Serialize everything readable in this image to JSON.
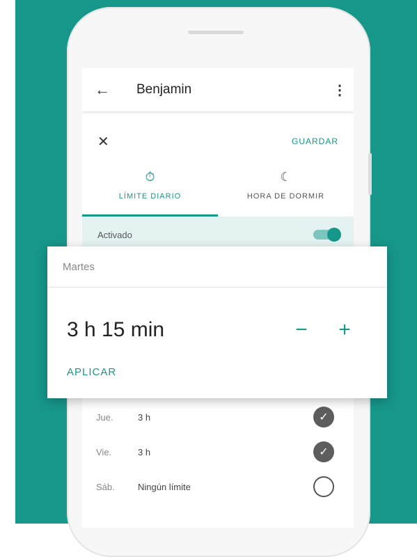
{
  "colors": {
    "accent": "#17968a",
    "background": "#17968a"
  },
  "appbar": {
    "back_icon": "arrow-back-icon",
    "title": "Benjamin",
    "more_icon": "more-vert-icon"
  },
  "dialog": {
    "close_icon": "close-icon",
    "save_label": "GUARDAR"
  },
  "tabs": [
    {
      "label": "LÍMITE DIARIO",
      "icon": "timer-icon",
      "active": true
    },
    {
      "label": "HORA DE DORMIR",
      "icon": "moon-icon",
      "active": false
    }
  ],
  "activated": {
    "label": "Activado",
    "on": true
  },
  "days": [
    {
      "day": "Jue.",
      "value": "3 h",
      "checked": true
    },
    {
      "day": "Vie.",
      "value": "3 h",
      "checked": true
    },
    {
      "day": "Sáb.",
      "value": "Ningún límite",
      "checked": false
    }
  ],
  "card": {
    "day_label": "Martes",
    "time_value": "3 h 15 min",
    "minus_label": "−",
    "plus_label": "+",
    "apply_label": "APLICAR"
  }
}
